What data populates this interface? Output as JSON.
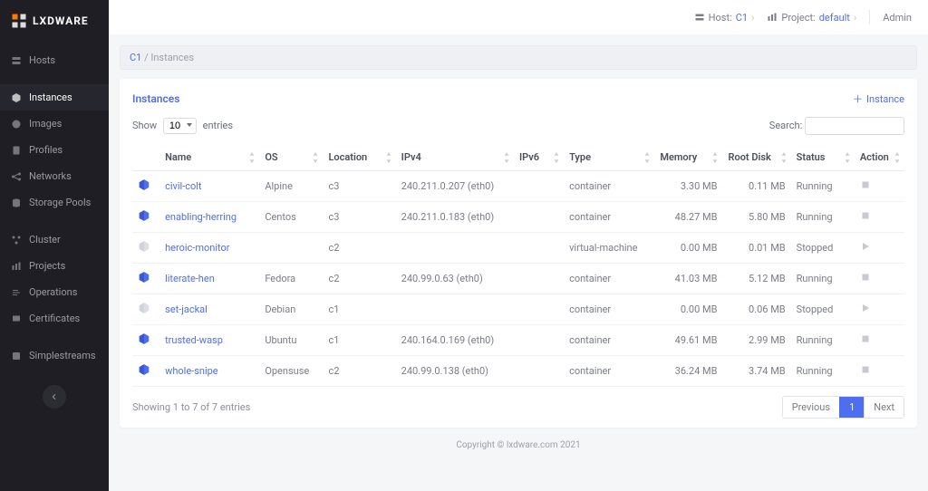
{
  "brand": "LXDWARE",
  "topbar": {
    "host_label": "Host:",
    "host_value": "C1",
    "project_label": "Project:",
    "project_value": "default",
    "admin": "Admin"
  },
  "breadcrumb": {
    "root": "C1",
    "current": "Instances"
  },
  "sidebar": {
    "items": [
      {
        "label": "Hosts"
      },
      {
        "label": "Instances"
      },
      {
        "label": "Images"
      },
      {
        "label": "Profiles"
      },
      {
        "label": "Networks"
      },
      {
        "label": "Storage Pools"
      },
      {
        "label": "Cluster"
      },
      {
        "label": "Projects"
      },
      {
        "label": "Operations"
      },
      {
        "label": "Certificates"
      },
      {
        "label": "Simplestreams"
      }
    ]
  },
  "card": {
    "title": "Instances",
    "add_label": "Instance"
  },
  "toolbar": {
    "show": "Show",
    "entries": "entries",
    "page_size": "10",
    "search_label": "Search:"
  },
  "columns": [
    "",
    "Name",
    "OS",
    "Location",
    "IPv4",
    "IPv6",
    "Type",
    "Memory",
    "Root Disk",
    "Status",
    "Action"
  ],
  "rows": [
    {
      "name": "civil-colt",
      "os": "Alpine",
      "location": "c3",
      "ipv4": "240.211.0.207 (eth0)",
      "ipv6": "",
      "type": "container",
      "memory": "3.30 MB",
      "disk": "0.11 MB",
      "status": "Running",
      "running": true
    },
    {
      "name": "enabling-herring",
      "os": "Centos",
      "location": "c3",
      "ipv4": "240.211.0.183 (eth0)",
      "ipv6": "",
      "type": "container",
      "memory": "48.27 MB",
      "disk": "5.80 MB",
      "status": "Running",
      "running": true
    },
    {
      "name": "heroic-monitor",
      "os": "",
      "location": "c2",
      "ipv4": "",
      "ipv6": "",
      "type": "virtual-machine",
      "memory": "0.00 MB",
      "disk": "0.01 MB",
      "status": "Stopped",
      "running": false
    },
    {
      "name": "literate-hen",
      "os": "Fedora",
      "location": "c2",
      "ipv4": "240.99.0.63 (eth0)",
      "ipv6": "",
      "type": "container",
      "memory": "41.03 MB",
      "disk": "5.12 MB",
      "status": "Running",
      "running": true
    },
    {
      "name": "set-jackal",
      "os": "Debian",
      "location": "c1",
      "ipv4": "",
      "ipv6": "",
      "type": "container",
      "memory": "0.00 MB",
      "disk": "0.06 MB",
      "status": "Stopped",
      "running": false
    },
    {
      "name": "trusted-wasp",
      "os": "Ubuntu",
      "location": "c1",
      "ipv4": "240.164.0.169 (eth0)",
      "ipv6": "",
      "type": "container",
      "memory": "49.61 MB",
      "disk": "2.99 MB",
      "status": "Running",
      "running": true
    },
    {
      "name": "whole-snipe",
      "os": "Opensuse",
      "location": "c2",
      "ipv4": "240.99.0.138 (eth0)",
      "ipv6": "",
      "type": "container",
      "memory": "36.24 MB",
      "disk": "3.74 MB",
      "status": "Running",
      "running": true
    }
  ],
  "table_info": "Showing 1 to 7 of 7 entries",
  "pager": {
    "prev": "Previous",
    "page": "1",
    "next": "Next"
  },
  "footer": "Copyright © lxdware.com 2021"
}
